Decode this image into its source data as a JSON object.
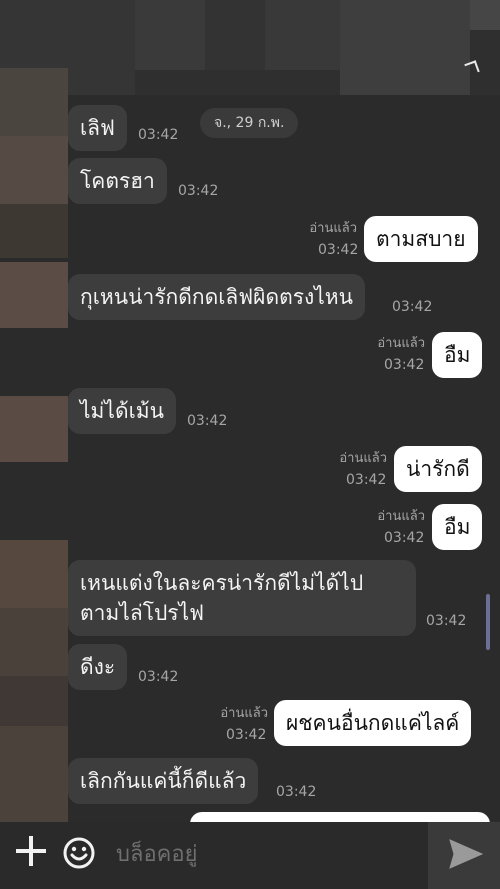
{
  "header": {
    "date": "จ., 29 ก.พ."
  },
  "messages": [
    {
      "dir": "in",
      "text": "เลิฟ",
      "time": "03:42"
    },
    {
      "dir": "in",
      "text": "โคตรฮา",
      "time": "03:42"
    },
    {
      "dir": "out",
      "text": "ตามสบาย",
      "time": "03:42",
      "read": "อ่านแล้ว"
    },
    {
      "dir": "in",
      "text": "กุเหนน่ารักดีกดเลิฟผิดตรงไหน",
      "time": "03:42"
    },
    {
      "dir": "out",
      "text": "อืม",
      "time": "03:42",
      "read": "อ่านแล้ว"
    },
    {
      "dir": "in",
      "text": "ไม่ได้เม้น",
      "time": "03:42"
    },
    {
      "dir": "out",
      "text": "น่ารักดี",
      "time": "03:42",
      "read": "อ่านแล้ว"
    },
    {
      "dir": "out",
      "text": "อืม",
      "time": "03:42",
      "read": "อ่านแล้ว"
    },
    {
      "dir": "in",
      "text_line1": "เหนแต่งในละครน่ารักดีไม่ได้ไป",
      "text_line2": "ตามไล่โปรไฟ",
      "time": "03:42"
    },
    {
      "dir": "in",
      "text": "ดีงะ",
      "time": "03:42"
    },
    {
      "dir": "out",
      "text": "ผชคนอื่นกดแค่ไลค์",
      "time": "03:42",
      "read": "อ่านแล้ว"
    },
    {
      "dir": "in",
      "text": "เลิกกันแค่นี้ก็ดีแล้ว",
      "time": "03:42"
    }
  ],
  "composer": {
    "placeholder": "บล็อคอยู่"
  },
  "icons": {
    "add": "plus-icon",
    "emoji": "emoji-icon",
    "send": "send-icon",
    "back": "chevron-icon"
  },
  "colors": {
    "background": "#2b2b2b",
    "incoming_bubble": "#3d3d3d",
    "outgoing_bubble": "#ffffff",
    "scroll_indicator": "#6d6f94"
  }
}
